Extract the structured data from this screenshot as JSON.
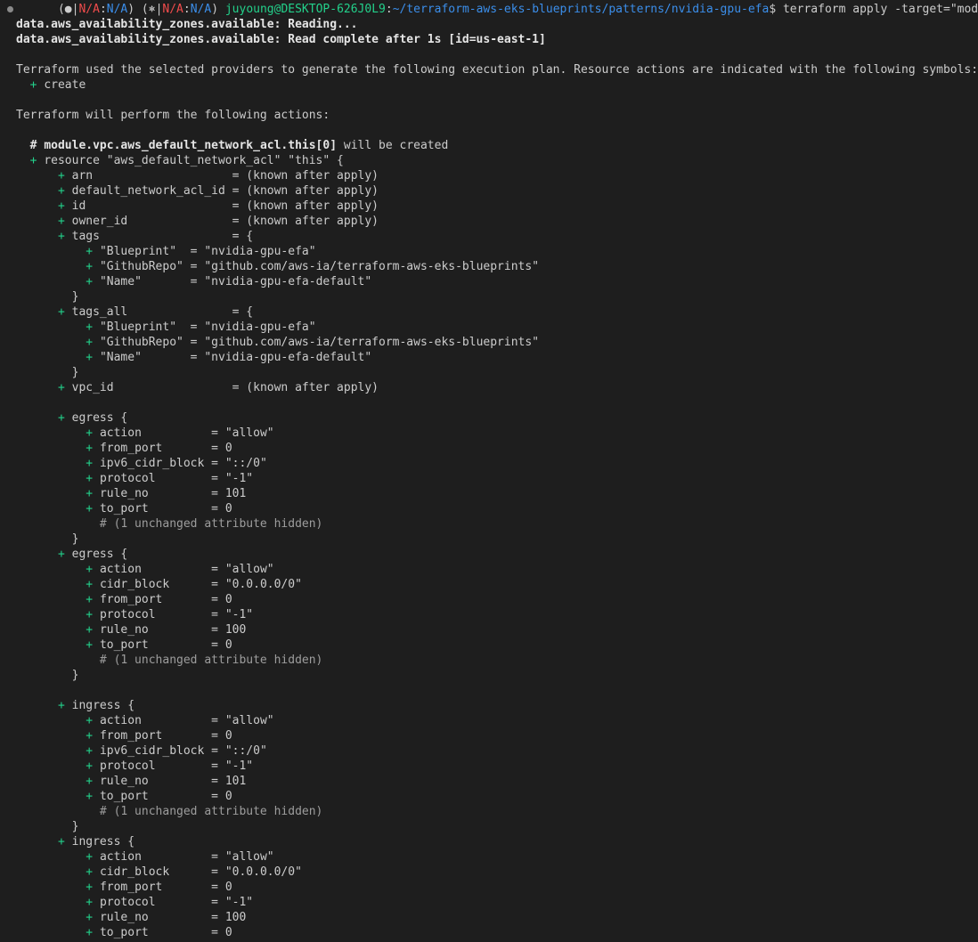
{
  "prompt": {
    "env1_open": "(",
    "env1_marker": "●",
    "env1_sep": "|",
    "env1_a": "N/A",
    "env1_colon": ":",
    "env1_b": "N/A",
    "env1_close": ")",
    "env2_open": "(",
    "env2_marker": "⎈",
    "env2_sep": "|",
    "env2_a": "N/A",
    "env2_colon": ":",
    "env2_b": "N/A",
    "env2_close": ")",
    "user_host": "juyoung@DESKTOP-626J0L9",
    "colon": ":",
    "path": "~/terraform-aws-eks-blueprints/patterns/nvidia-gpu-efa",
    "dollar": "$",
    "command": "terraform apply -target=\"module.vpc\" -auto-approve"
  },
  "output": {
    "l1": "data.aws_availability_zones.available: Reading...",
    "l2": "data.aws_availability_zones.available: Read complete after 1s [id=us-east-1]",
    "l3": "Terraform used the selected providers to generate the following execution plan. Resource actions are indicated with the following symbols:",
    "l4_plus": "+",
    "l4": "create",
    "l5": "Terraform will perform the following actions:",
    "l6_hash": "#",
    "l6_res": "module.vpc.aws_default_network_acl.this[0]",
    "l6_rest": "will be created",
    "l7": "resource \"aws_default_network_acl\" \"this\" {",
    "arn": "arn                    = (known after apply)",
    "default_nacl_id": "default_network_acl_id = (known after apply)",
    "id": "id                     = (known after apply)",
    "owner_id": "owner_id               = (known after apply)",
    "tags_open": "tags                   = {",
    "tags_blueprint": "\"Blueprint\"  = \"nvidia-gpu-efa\"",
    "tags_repo": "\"GithubRepo\" = \"github.com/aws-ia/terraform-aws-eks-blueprints\"",
    "tags_name": "\"Name\"       = \"nvidia-gpu-efa-default\"",
    "close_brace": "}",
    "tags_all_open": "tags_all               = {",
    "vpc_id": "vpc_id                 = (known after apply)",
    "egress_open": "egress {",
    "ingress_open": "ingress {",
    "action": "action          = \"allow\"",
    "from_port": "from_port       = 0",
    "ipv6_cidr": "ipv6_cidr_block = \"::/0\"",
    "cidr": "cidr_block      = \"0.0.0.0/0\"",
    "protocol": "protocol        = \"-1\"",
    "rule_101": "rule_no         = 101",
    "rule_100": "rule_no         = 100",
    "to_port": "to_port         = 0",
    "hidden": "# (1 unchanged attribute hidden)",
    "plus": "+"
  },
  "colors": {
    "background": "#1e1e1e",
    "text": "#cccccc",
    "plus_green": "#23d18b",
    "path_blue": "#3b8eea",
    "na_red": "#f14c4c"
  }
}
